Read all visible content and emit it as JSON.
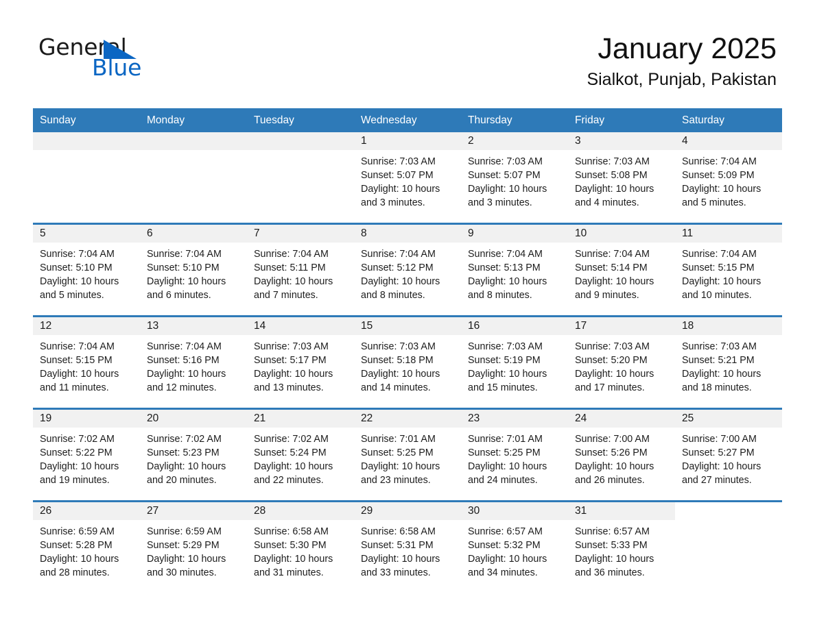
{
  "brand": {
    "word_one": "General",
    "word_two": "Blue",
    "triangle_color": "#0b66c3"
  },
  "header": {
    "month_title": "January 2025",
    "location": "Sialkot, Punjab, Pakistan"
  },
  "theme": {
    "header_blue": "#2e7ab8",
    "band_gray": "#f1f1f1",
    "text_dark": "#1a1a1a",
    "brand_blue": "#0b66c3"
  },
  "weekdays": [
    "Sunday",
    "Monday",
    "Tuesday",
    "Wednesday",
    "Thursday",
    "Friday",
    "Saturday"
  ],
  "weeks": [
    [
      {
        "day": "",
        "lines": []
      },
      {
        "day": "",
        "lines": []
      },
      {
        "day": "",
        "lines": []
      },
      {
        "day": "1",
        "lines": [
          "Sunrise: 7:03 AM",
          "Sunset: 5:07 PM",
          "Daylight: 10 hours",
          "and 3 minutes."
        ]
      },
      {
        "day": "2",
        "lines": [
          "Sunrise: 7:03 AM",
          "Sunset: 5:07 PM",
          "Daylight: 10 hours",
          "and 3 minutes."
        ]
      },
      {
        "day": "3",
        "lines": [
          "Sunrise: 7:03 AM",
          "Sunset: 5:08 PM",
          "Daylight: 10 hours",
          "and 4 minutes."
        ]
      },
      {
        "day": "4",
        "lines": [
          "Sunrise: 7:04 AM",
          "Sunset: 5:09 PM",
          "Daylight: 10 hours",
          "and 5 minutes."
        ]
      }
    ],
    [
      {
        "day": "5",
        "lines": [
          "Sunrise: 7:04 AM",
          "Sunset: 5:10 PM",
          "Daylight: 10 hours",
          "and 5 minutes."
        ]
      },
      {
        "day": "6",
        "lines": [
          "Sunrise: 7:04 AM",
          "Sunset: 5:10 PM",
          "Daylight: 10 hours",
          "and 6 minutes."
        ]
      },
      {
        "day": "7",
        "lines": [
          "Sunrise: 7:04 AM",
          "Sunset: 5:11 PM",
          "Daylight: 10 hours",
          "and 7 minutes."
        ]
      },
      {
        "day": "8",
        "lines": [
          "Sunrise: 7:04 AM",
          "Sunset: 5:12 PM",
          "Daylight: 10 hours",
          "and 8 minutes."
        ]
      },
      {
        "day": "9",
        "lines": [
          "Sunrise: 7:04 AM",
          "Sunset: 5:13 PM",
          "Daylight: 10 hours",
          "and 8 minutes."
        ]
      },
      {
        "day": "10",
        "lines": [
          "Sunrise: 7:04 AM",
          "Sunset: 5:14 PM",
          "Daylight: 10 hours",
          "and 9 minutes."
        ]
      },
      {
        "day": "11",
        "lines": [
          "Sunrise: 7:04 AM",
          "Sunset: 5:15 PM",
          "Daylight: 10 hours",
          "and 10 minutes."
        ]
      }
    ],
    [
      {
        "day": "12",
        "lines": [
          "Sunrise: 7:04 AM",
          "Sunset: 5:15 PM",
          "Daylight: 10 hours",
          "and 11 minutes."
        ]
      },
      {
        "day": "13",
        "lines": [
          "Sunrise: 7:04 AM",
          "Sunset: 5:16 PM",
          "Daylight: 10 hours",
          "and 12 minutes."
        ]
      },
      {
        "day": "14",
        "lines": [
          "Sunrise: 7:03 AM",
          "Sunset: 5:17 PM",
          "Daylight: 10 hours",
          "and 13 minutes."
        ]
      },
      {
        "day": "15",
        "lines": [
          "Sunrise: 7:03 AM",
          "Sunset: 5:18 PM",
          "Daylight: 10 hours",
          "and 14 minutes."
        ]
      },
      {
        "day": "16",
        "lines": [
          "Sunrise: 7:03 AM",
          "Sunset: 5:19 PM",
          "Daylight: 10 hours",
          "and 15 minutes."
        ]
      },
      {
        "day": "17",
        "lines": [
          "Sunrise: 7:03 AM",
          "Sunset: 5:20 PM",
          "Daylight: 10 hours",
          "and 17 minutes."
        ]
      },
      {
        "day": "18",
        "lines": [
          "Sunrise: 7:03 AM",
          "Sunset: 5:21 PM",
          "Daylight: 10 hours",
          "and 18 minutes."
        ]
      }
    ],
    [
      {
        "day": "19",
        "lines": [
          "Sunrise: 7:02 AM",
          "Sunset: 5:22 PM",
          "Daylight: 10 hours",
          "and 19 minutes."
        ]
      },
      {
        "day": "20",
        "lines": [
          "Sunrise: 7:02 AM",
          "Sunset: 5:23 PM",
          "Daylight: 10 hours",
          "and 20 minutes."
        ]
      },
      {
        "day": "21",
        "lines": [
          "Sunrise: 7:02 AM",
          "Sunset: 5:24 PM",
          "Daylight: 10 hours",
          "and 22 minutes."
        ]
      },
      {
        "day": "22",
        "lines": [
          "Sunrise: 7:01 AM",
          "Sunset: 5:25 PM",
          "Daylight: 10 hours",
          "and 23 minutes."
        ]
      },
      {
        "day": "23",
        "lines": [
          "Sunrise: 7:01 AM",
          "Sunset: 5:25 PM",
          "Daylight: 10 hours",
          "and 24 minutes."
        ]
      },
      {
        "day": "24",
        "lines": [
          "Sunrise: 7:00 AM",
          "Sunset: 5:26 PM",
          "Daylight: 10 hours",
          "and 26 minutes."
        ]
      },
      {
        "day": "25",
        "lines": [
          "Sunrise: 7:00 AM",
          "Sunset: 5:27 PM",
          "Daylight: 10 hours",
          "and 27 minutes."
        ]
      }
    ],
    [
      {
        "day": "26",
        "lines": [
          "Sunrise: 6:59 AM",
          "Sunset: 5:28 PM",
          "Daylight: 10 hours",
          "and 28 minutes."
        ]
      },
      {
        "day": "27",
        "lines": [
          "Sunrise: 6:59 AM",
          "Sunset: 5:29 PM",
          "Daylight: 10 hours",
          "and 30 minutes."
        ]
      },
      {
        "day": "28",
        "lines": [
          "Sunrise: 6:58 AM",
          "Sunset: 5:30 PM",
          "Daylight: 10 hours",
          "and 31 minutes."
        ]
      },
      {
        "day": "29",
        "lines": [
          "Sunrise: 6:58 AM",
          "Sunset: 5:31 PM",
          "Daylight: 10 hours",
          "and 33 minutes."
        ]
      },
      {
        "day": "30",
        "lines": [
          "Sunrise: 6:57 AM",
          "Sunset: 5:32 PM",
          "Daylight: 10 hours",
          "and 34 minutes."
        ]
      },
      {
        "day": "31",
        "lines": [
          "Sunrise: 6:57 AM",
          "Sunset: 5:33 PM",
          "Daylight: 10 hours",
          "and 36 minutes."
        ]
      },
      {
        "day": "",
        "lines": []
      }
    ]
  ]
}
